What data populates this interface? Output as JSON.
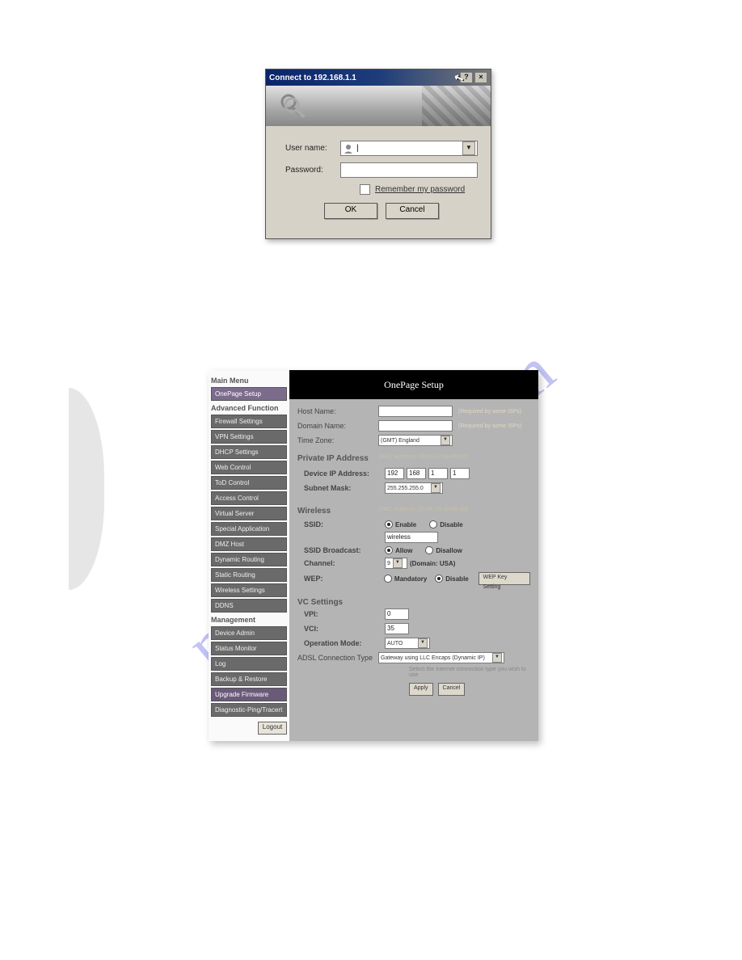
{
  "watermark_text": "manualshive.com",
  "dialog": {
    "title": "Connect to 192.168.1.1",
    "help_glyph": "?",
    "close_glyph": "×",
    "username_label": "User name:",
    "username_value": "|",
    "password_label": "Password:",
    "password_value": "",
    "remember_label": "Remember my password",
    "ok_label": "OK",
    "cancel_label": "Cancel"
  },
  "router": {
    "sidebar": {
      "heading_main": "Main Menu",
      "item_onepage": "OnePage Setup",
      "heading_adv": "Advanced Function",
      "adv_items": [
        "Firewall Settings",
        "VPN Settings",
        "DHCP Settings",
        "Web Control",
        "ToD Control",
        "Access Control",
        "Virtual Server",
        "Special Application",
        "DMZ Host",
        "Dynamic Routing",
        "Static Routing",
        "Wireless Settings",
        "DDNS"
      ],
      "heading_mgmt": "Management",
      "mgmt_items": [
        "Device Admin",
        "Status Monitor",
        "Log",
        "Backup & Restore",
        "Upgrade Firmware",
        "Diagnostic-Ping/Tracert"
      ],
      "logout_label": "Logout"
    },
    "header": "OnePage Setup",
    "fields": {
      "hostname_label": "Host Name:",
      "hostname_note": "(Required by some ISPs)",
      "domainname_label": "Domain Name:",
      "domainname_note": "(Required by some ISPs)",
      "timezone_label": "Time Zone:",
      "timezone_value": "(GMT) England",
      "privip_label": "Private IP Address",
      "mac1": "(MAC Address: 00-90-A2-08-06-08)",
      "devip_label": "Device IP Address:",
      "devip_oct": [
        "192",
        "168",
        "1",
        "1"
      ],
      "subnet_label": "Subnet Mask:",
      "subnet_value": "255.255.255.0",
      "wireless_label": "Wireless",
      "mac2": "(MAC Address: 00-0A-79-18-06-32)",
      "ssid_label": "SSID:",
      "enable_label": "Enable",
      "disable_label": "Disable",
      "ssid_value": "wireless",
      "ssidbc_label": "SSID Broadcast:",
      "allow_label": "Allow",
      "disallow_label": "Disallow",
      "channel_label": "Channel:",
      "channel_value": "9",
      "channel_note": "(Domain: USA)",
      "wep_label": "WEP:",
      "mandatory_label": "Mandatory",
      "wepdisable_label": "Disable",
      "wep_btn": "WEP Key Setting",
      "vcset_label": "VC Settings",
      "vpi_label": "VPI:",
      "vpi_value": "0",
      "vci_label": "VCI:",
      "vci_value": "35",
      "opmode_label": "Operation Mode:",
      "opmode_value": "AUTO",
      "adslconn_label": "ADSL Connection Type",
      "adslconn_value": "Gateway using LLC Encaps (Dynamic IP)",
      "adsl_note": "Select the Internet connection type you wish to use",
      "apply_label": "Apply",
      "cancel_label": "Cancel"
    }
  }
}
